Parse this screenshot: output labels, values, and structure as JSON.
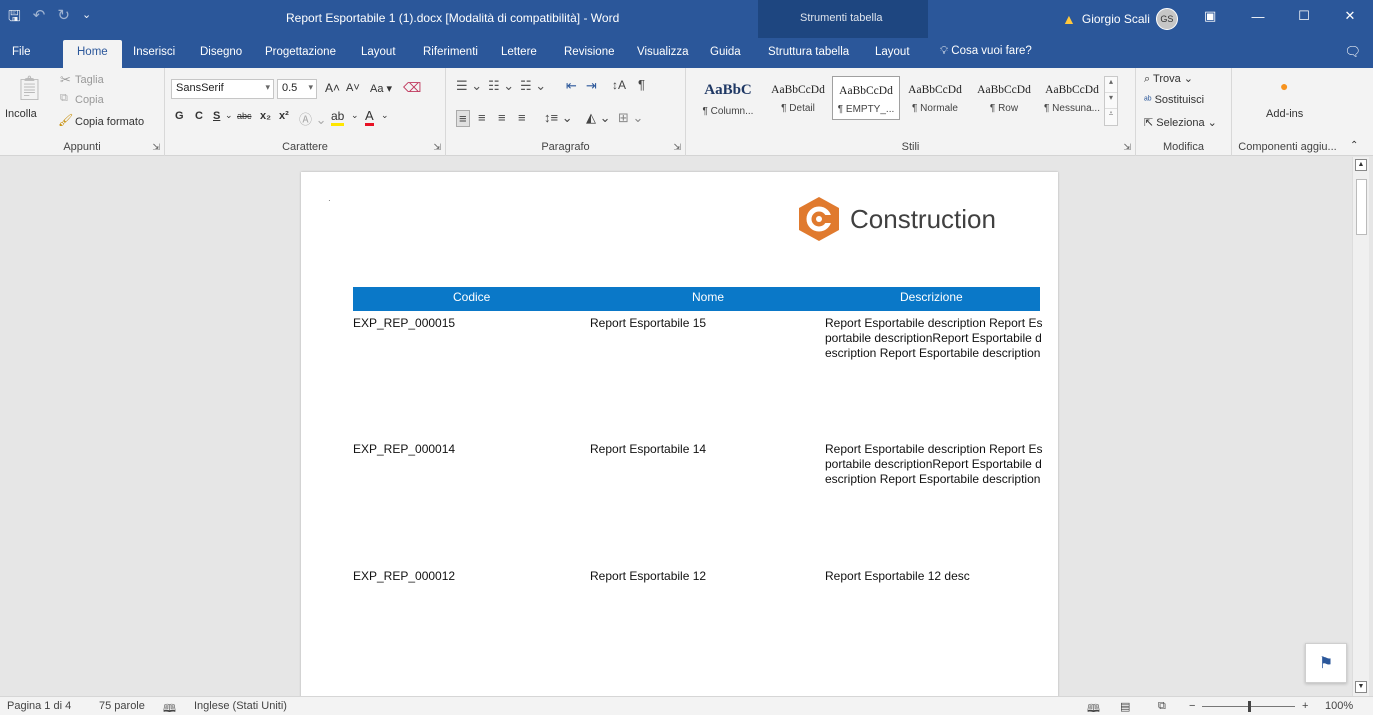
{
  "app": {
    "window_title": "Report Esportabile 1 (1).docx [Modalità di compatibilità]  -  Word",
    "context_tab_group": "Strumenti tabella",
    "user_name": "Giorgio Scali",
    "user_initials": "GS"
  },
  "tabs": [
    {
      "label": "File"
    },
    {
      "label": "Home"
    },
    {
      "label": "Inserisci"
    },
    {
      "label": "Disegno"
    },
    {
      "label": "Progettazione"
    },
    {
      "label": "Layout"
    },
    {
      "label": "Riferimenti"
    },
    {
      "label": "Lettere"
    },
    {
      "label": "Revisione"
    },
    {
      "label": "Visualizza"
    },
    {
      "label": "Guida"
    },
    {
      "label": "Struttura tabella"
    },
    {
      "label": "Layout"
    }
  ],
  "tell_me": "Cosa vuoi fare?",
  "ribbon": {
    "clipboard": {
      "paste": "Incolla",
      "cut": "Taglia",
      "copy": "Copia",
      "format_painter": "Copia formato",
      "group": "Appunti"
    },
    "font": {
      "font_name": "SansSerif",
      "font_size": "0.5",
      "case": "Aa",
      "bold": "G",
      "italic": "C",
      "underline": "S",
      "strike": "abc",
      "group": "Carattere"
    },
    "paragraph": {
      "group": "Paragrafo"
    },
    "styles": {
      "group": "Stili",
      "items": [
        {
          "sample": "AaBbC",
          "name": "¶ Column..."
        },
        {
          "sample": "AaBbCcDd",
          "name": "¶ Detail"
        },
        {
          "sample": "AaBbCcDd",
          "name": "¶ EMPTY_..."
        },
        {
          "sample": "AaBbCcDd",
          "name": "¶ Normale"
        },
        {
          "sample": "AaBbCcDd",
          "name": "¶ Row"
        },
        {
          "sample": "AaBbCcDd",
          "name": "¶ Nessuna..."
        }
      ]
    },
    "editing": {
      "find": "Trova",
      "replace": "Sostituisci",
      "select": "Seleziona",
      "group": "Modifica"
    },
    "addins": {
      "label": "Add-ins",
      "group": "Componenti aggiu..."
    }
  },
  "document": {
    "logo_text": "Construction",
    "brand_color": "#e07a2e",
    "table": {
      "headers": [
        "Codice",
        "Nome",
        "Descrizione"
      ],
      "rows": [
        {
          "code": "EXP_REP_000015",
          "name": "Report Esportabile  15",
          "desc": "Report Esportabile description Report Esportabile descriptionReport Esportabile description Report Esportabile description"
        },
        {
          "code": "EXP_REP_000014",
          "name": "Report Esportabile  14",
          "desc": "Report Esportabile description Report Esportabile descriptionReport Esportabile description Report Esportabile description"
        },
        {
          "code": "EXP_REP_000012",
          "name": "Report Esportabile  12",
          "desc": "Report Esportabile  12 desc"
        }
      ]
    }
  },
  "status": {
    "page": "Pagina 1 di 4",
    "words": "75 parole",
    "language": "Inglese (Stati Uniti)",
    "zoom": "100%"
  },
  "colors": {
    "word_blue": "#2b579a",
    "table_header": "#0a78c8"
  }
}
